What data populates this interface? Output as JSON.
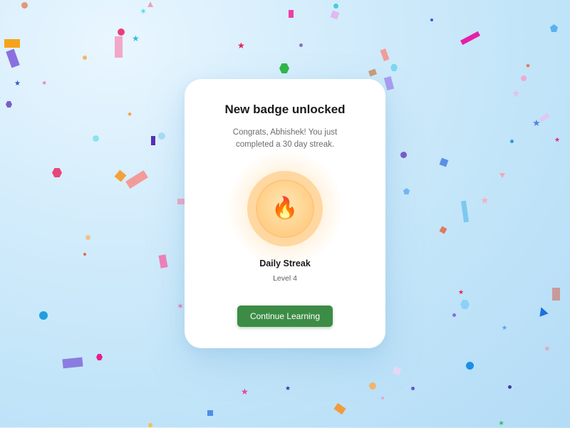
{
  "modal": {
    "title": "New badge unlocked",
    "subtitle": "Congrats, Abhishek! You just completed a 30 day streak.",
    "badge": {
      "icon": "fire-emoji",
      "emoji": "🔥",
      "name": "Daily Streak",
      "level": "Level 4"
    },
    "cta_label": "Continue Learning"
  },
  "colors": {
    "cta_background": "#3d8c45",
    "badge_ring": "#ffd7a1",
    "badge_core": "#ffc27a",
    "background": "#c6e6f9"
  },
  "decoration": "confetti"
}
